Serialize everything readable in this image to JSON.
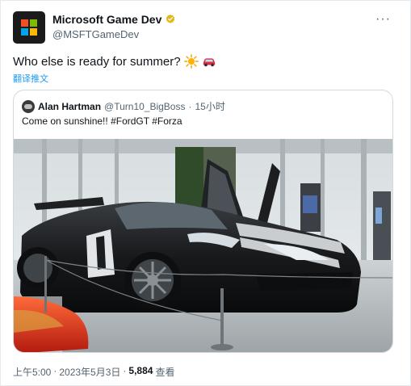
{
  "author": {
    "name": "Microsoft Game Dev",
    "handle": "@MSFTGameDev",
    "logo_colors": [
      "#f25022",
      "#7fba00",
      "#00a4ef",
      "#ffb900"
    ],
    "verified_badge_color": "#e2b719"
  },
  "tweet": {
    "text": "Who else is ready for summer?",
    "emojis": [
      "sun-icon",
      "red-car-icon"
    ],
    "translate_label": "翻译推文"
  },
  "quote": {
    "author_name": "Alan Hartman",
    "author_handle": "@Turn10_BigBoss",
    "separator": "·",
    "time": "15小时",
    "text": "Come on sunshine!! #FordGT #Forza",
    "image_alt": "black-ford-gt-showroom-photo"
  },
  "meta": {
    "time": "上午5:00",
    "separator": "·",
    "date": "2023年5月3日",
    "views_count": "5,884",
    "views_label": "查看"
  },
  "colors": {
    "link": "#1d9bf0",
    "secondary_text": "#536471",
    "border": "#cfd9de"
  }
}
